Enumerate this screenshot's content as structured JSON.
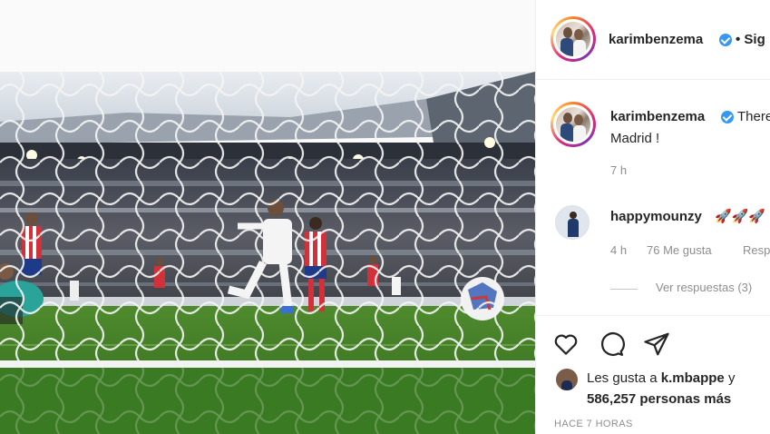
{
  "post": {
    "author": "karimbenzema",
    "follow_prefix": "• Sig",
    "caption_start": "There",
    "caption_line2": "Madrid !",
    "caption_age": "7 h"
  },
  "comment": {
    "user": "happymounzy",
    "text": "🚀🚀🚀 !",
    "age": "4 h",
    "likes": "76 Me gusta",
    "reply": "Resp",
    "view_replies": "Ver respuestas (3)"
  },
  "likes": {
    "prefix": "Les gusta a",
    "liker": "k.mbappe",
    "conj": "y",
    "count": "586,257 personas más"
  },
  "timestamp": "HACE 7 HORAS",
  "icons": {
    "like": "heart-icon",
    "comment": "comment-icon",
    "share": "share-icon",
    "verified": "verified-badge-icon"
  },
  "colors": {
    "verified": "#3897f0",
    "text": "#262626",
    "muted": "#8e8e8e"
  }
}
